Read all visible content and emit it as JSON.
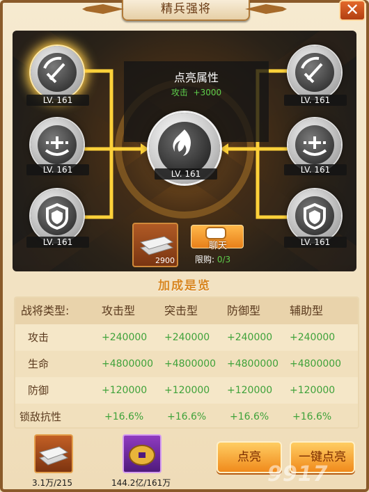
{
  "window": {
    "title": "精兵强将",
    "close_icon": "close-icon"
  },
  "panel": {
    "title": "点亮属性",
    "attr_label": "攻击",
    "attr_value": "+3000"
  },
  "nodes": {
    "left": [
      {
        "level": "LV. 161",
        "icon": "sword-icon"
      },
      {
        "level": "LV. 161",
        "icon": "heal-plus-icon"
      },
      {
        "level": "LV. 161",
        "icon": "shield-icon"
      }
    ],
    "right": [
      {
        "level": "LV. 161",
        "icon": "sword-icon"
      },
      {
        "level": "LV. 161",
        "icon": "heal-plus-icon"
      },
      {
        "level": "LV. 161",
        "icon": "shield-icon"
      }
    ],
    "center": {
      "level": "LV. 161",
      "icon": "flame-emblem-icon"
    }
  },
  "item": {
    "count": "2900",
    "icon": "silver-ingot-icon"
  },
  "chat": {
    "label": "聊天"
  },
  "limit": {
    "label": "限购:",
    "value": "0/3"
  },
  "bonus": {
    "title": "加成是览",
    "headers": [
      "战将类型:",
      "攻击型",
      "突击型",
      "防御型",
      "辅助型"
    ],
    "rows": [
      {
        "label": "攻击",
        "values": [
          "+240000",
          "+240000",
          "+240000",
          "+240000"
        ]
      },
      {
        "label": "生命",
        "values": [
          "+4800000",
          "+4800000",
          "+4800000",
          "+4800000"
        ]
      },
      {
        "label": "防御",
        "values": [
          "+120000",
          "+120000",
          "+120000",
          "+120000"
        ]
      },
      {
        "label": "锁敌抗性",
        "values": [
          "+16.6%",
          "+16.6%",
          "+16.6%",
          "+16.6%"
        ]
      }
    ]
  },
  "resources": {
    "silver": {
      "value": "3.1万/215",
      "icon": "silver-ingot-icon"
    },
    "coin": {
      "value": "144.2亿/161万",
      "icon": "gold-coin-icon"
    }
  },
  "buttons": {
    "light": "点亮",
    "light_all": "一键点亮"
  },
  "watermark": "9917"
}
